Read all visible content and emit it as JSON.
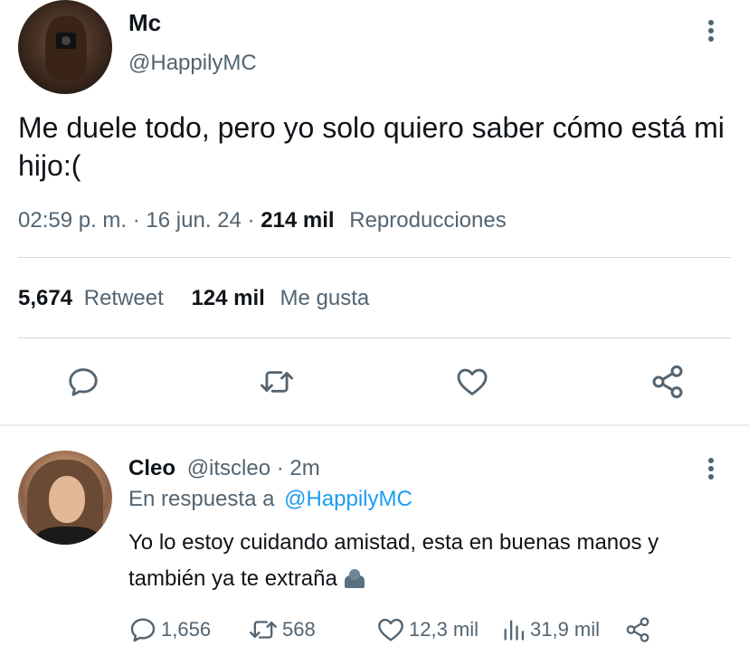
{
  "tweet": {
    "display_name": "Mc",
    "handle": "@HappilyMC",
    "text": "Me duele todo, pero yo solo quiero saber cómo está mi hijo:(",
    "time": "02:59 p. m.",
    "date": "16 jun. 24",
    "views_count": "214 mil",
    "views_label": "Reproducciones",
    "retweets_count": "5,674",
    "retweets_label": "Retweet",
    "likes_count": "124 mil",
    "likes_label": "Me gusta",
    "actions": [
      {
        "icon": "reply-icon"
      },
      {
        "icon": "retweet-icon"
      },
      {
        "icon": "heart-icon"
      },
      {
        "icon": "share-icon"
      }
    ]
  },
  "reply": {
    "display_name": "Cleo",
    "handle": "@itscleo",
    "age": "2m",
    "reply_prefix": "En respuesta a",
    "reply_to": "@HappilyMC",
    "text": "Yo lo estoy cuidando amistad, esta en buenas manos y también ya te extraña",
    "emoji": "busts-in-silhouette-icon",
    "replies": "1,656",
    "retweets": "568",
    "likes": "12,3 mil",
    "views": "31,9 mil"
  },
  "colors": {
    "text": "#0f1419",
    "secondary": "#536471",
    "link": "#1d9bf0",
    "divider": "#cfd9de"
  }
}
